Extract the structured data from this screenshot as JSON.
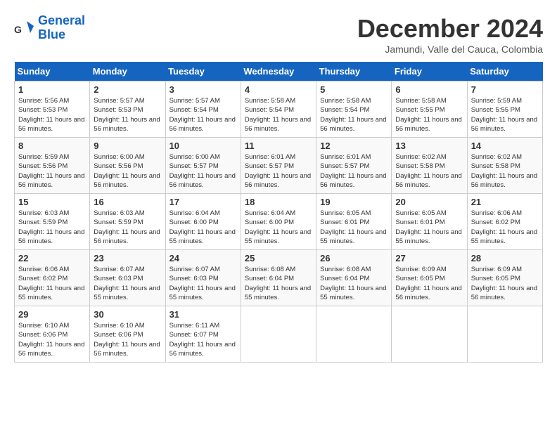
{
  "header": {
    "logo_line1": "General",
    "logo_line2": "Blue",
    "title": "December 2024",
    "subtitle": "Jamundi, Valle del Cauca, Colombia"
  },
  "weekdays": [
    "Sunday",
    "Monday",
    "Tuesday",
    "Wednesday",
    "Thursday",
    "Friday",
    "Saturday"
  ],
  "weeks": [
    [
      {
        "day": "1",
        "sunrise": "5:56 AM",
        "sunset": "5:53 PM",
        "daylight": "11 hours and 56 minutes."
      },
      {
        "day": "2",
        "sunrise": "5:57 AM",
        "sunset": "5:53 PM",
        "daylight": "11 hours and 56 minutes."
      },
      {
        "day": "3",
        "sunrise": "5:57 AM",
        "sunset": "5:54 PM",
        "daylight": "11 hours and 56 minutes."
      },
      {
        "day": "4",
        "sunrise": "5:58 AM",
        "sunset": "5:54 PM",
        "daylight": "11 hours and 56 minutes."
      },
      {
        "day": "5",
        "sunrise": "5:58 AM",
        "sunset": "5:54 PM",
        "daylight": "11 hours and 56 minutes."
      },
      {
        "day": "6",
        "sunrise": "5:58 AM",
        "sunset": "5:55 PM",
        "daylight": "11 hours and 56 minutes."
      },
      {
        "day": "7",
        "sunrise": "5:59 AM",
        "sunset": "5:55 PM",
        "daylight": "11 hours and 56 minutes."
      }
    ],
    [
      {
        "day": "8",
        "sunrise": "5:59 AM",
        "sunset": "5:56 PM",
        "daylight": "11 hours and 56 minutes."
      },
      {
        "day": "9",
        "sunrise": "6:00 AM",
        "sunset": "5:56 PM",
        "daylight": "11 hours and 56 minutes."
      },
      {
        "day": "10",
        "sunrise": "6:00 AM",
        "sunset": "5:57 PM",
        "daylight": "11 hours and 56 minutes."
      },
      {
        "day": "11",
        "sunrise": "6:01 AM",
        "sunset": "5:57 PM",
        "daylight": "11 hours and 56 minutes."
      },
      {
        "day": "12",
        "sunrise": "6:01 AM",
        "sunset": "5:57 PM",
        "daylight": "11 hours and 56 minutes."
      },
      {
        "day": "13",
        "sunrise": "6:02 AM",
        "sunset": "5:58 PM",
        "daylight": "11 hours and 56 minutes."
      },
      {
        "day": "14",
        "sunrise": "6:02 AM",
        "sunset": "5:58 PM",
        "daylight": "11 hours and 56 minutes."
      }
    ],
    [
      {
        "day": "15",
        "sunrise": "6:03 AM",
        "sunset": "5:59 PM",
        "daylight": "11 hours and 56 minutes."
      },
      {
        "day": "16",
        "sunrise": "6:03 AM",
        "sunset": "5:59 PM",
        "daylight": "11 hours and 56 minutes."
      },
      {
        "day": "17",
        "sunrise": "6:04 AM",
        "sunset": "6:00 PM",
        "daylight": "11 hours and 55 minutes."
      },
      {
        "day": "18",
        "sunrise": "6:04 AM",
        "sunset": "6:00 PM",
        "daylight": "11 hours and 55 minutes."
      },
      {
        "day": "19",
        "sunrise": "6:05 AM",
        "sunset": "6:01 PM",
        "daylight": "11 hours and 55 minutes."
      },
      {
        "day": "20",
        "sunrise": "6:05 AM",
        "sunset": "6:01 PM",
        "daylight": "11 hours and 55 minutes."
      },
      {
        "day": "21",
        "sunrise": "6:06 AM",
        "sunset": "6:02 PM",
        "daylight": "11 hours and 55 minutes."
      }
    ],
    [
      {
        "day": "22",
        "sunrise": "6:06 AM",
        "sunset": "6:02 PM",
        "daylight": "11 hours and 55 minutes."
      },
      {
        "day": "23",
        "sunrise": "6:07 AM",
        "sunset": "6:03 PM",
        "daylight": "11 hours and 55 minutes."
      },
      {
        "day": "24",
        "sunrise": "6:07 AM",
        "sunset": "6:03 PM",
        "daylight": "11 hours and 55 minutes."
      },
      {
        "day": "25",
        "sunrise": "6:08 AM",
        "sunset": "6:04 PM",
        "daylight": "11 hours and 55 minutes."
      },
      {
        "day": "26",
        "sunrise": "6:08 AM",
        "sunset": "6:04 PM",
        "daylight": "11 hours and 55 minutes."
      },
      {
        "day": "27",
        "sunrise": "6:09 AM",
        "sunset": "6:05 PM",
        "daylight": "11 hours and 56 minutes."
      },
      {
        "day": "28",
        "sunrise": "6:09 AM",
        "sunset": "6:05 PM",
        "daylight": "11 hours and 56 minutes."
      }
    ],
    [
      {
        "day": "29",
        "sunrise": "6:10 AM",
        "sunset": "6:06 PM",
        "daylight": "11 hours and 56 minutes."
      },
      {
        "day": "30",
        "sunrise": "6:10 AM",
        "sunset": "6:06 PM",
        "daylight": "11 hours and 56 minutes."
      },
      {
        "day": "31",
        "sunrise": "6:11 AM",
        "sunset": "6:07 PM",
        "daylight": "11 hours and 56 minutes."
      },
      null,
      null,
      null,
      null
    ]
  ]
}
